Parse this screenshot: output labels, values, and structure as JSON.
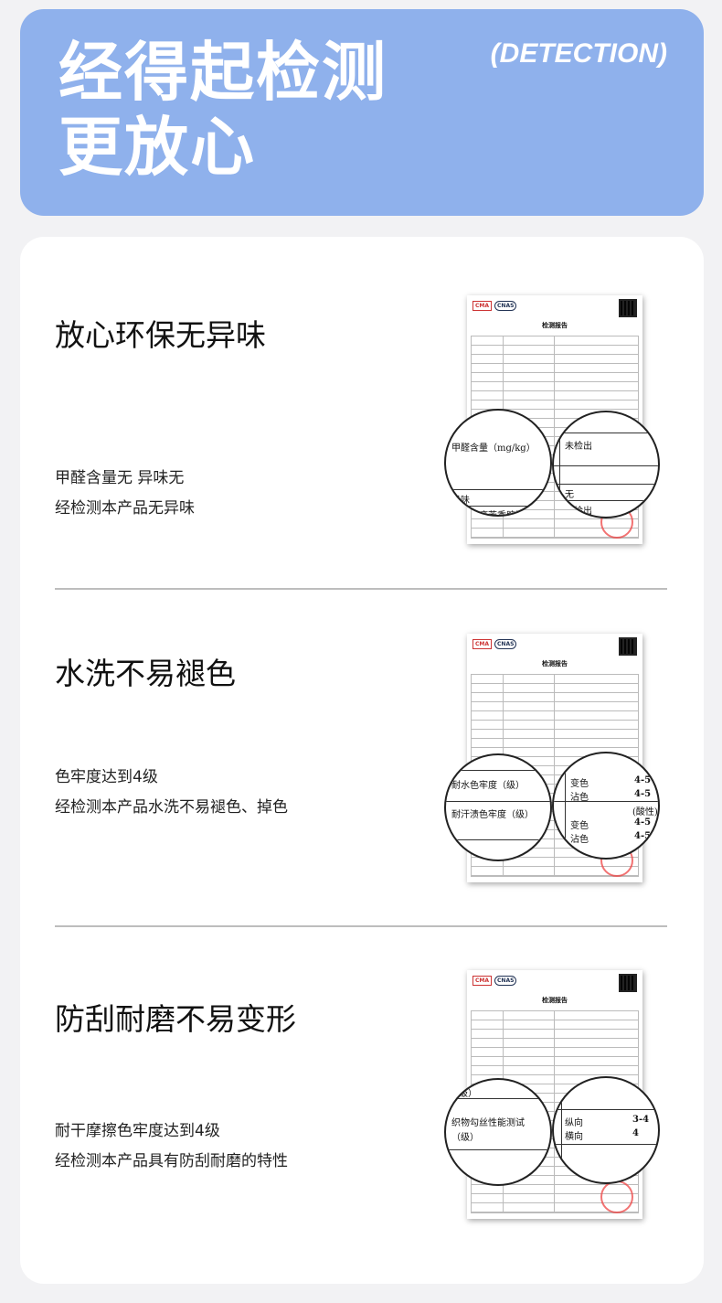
{
  "header": {
    "title_line1": "经得起检测",
    "title_line2": "更放心",
    "tag": "(DETECTION)"
  },
  "report_doc": {
    "logo_cma": "CMA",
    "logo_cnas": "CNAS",
    "title": "检测报告"
  },
  "sections": [
    {
      "title": "放心环保无异味",
      "desc_line1": "甲醛含量无 异味无",
      "desc_line2": "经检测本产品无异味",
      "mag_left": {
        "row1": "甲醛含量（mg/kg）",
        "row2": "异味",
        "row3": "分解致癌芳香胺染"
      },
      "mag_right": {
        "row1": "未检出",
        "row2": "无",
        "row3": "未检出"
      }
    },
    {
      "title": "水洗不易褪色",
      "desc_line1": "色牢度达到4级",
      "desc_line2": "经检测本产品水洗不易褪色、掉色",
      "mag_left": {
        "row1": "耐水色牢度（级）",
        "row2": "耐汗渍色牢度（级）"
      },
      "mag_right": {
        "r1a": "变色",
        "r1b": "4-5",
        "r2a": "沾色",
        "r2b": "4-5",
        "r3": "(酸性)",
        "r4a": "变色",
        "r4b": "4-5",
        "r5a": "沾色",
        "r5b": "4-5"
      }
    },
    {
      "title": "防刮耐磨不易变形",
      "desc_line1": "耐干摩擦色牢度达到4级",
      "desc_line2": "经检测本产品具有防刮耐磨的特性",
      "mag_left": {
        "row0": "（级）",
        "row1": "织物勾丝性能测试",
        "row2": "（级）"
      },
      "mag_right": {
        "r1a": "纵向",
        "r1b": "3-4",
        "r2a": "横向",
        "r2b": "4"
      }
    }
  ]
}
